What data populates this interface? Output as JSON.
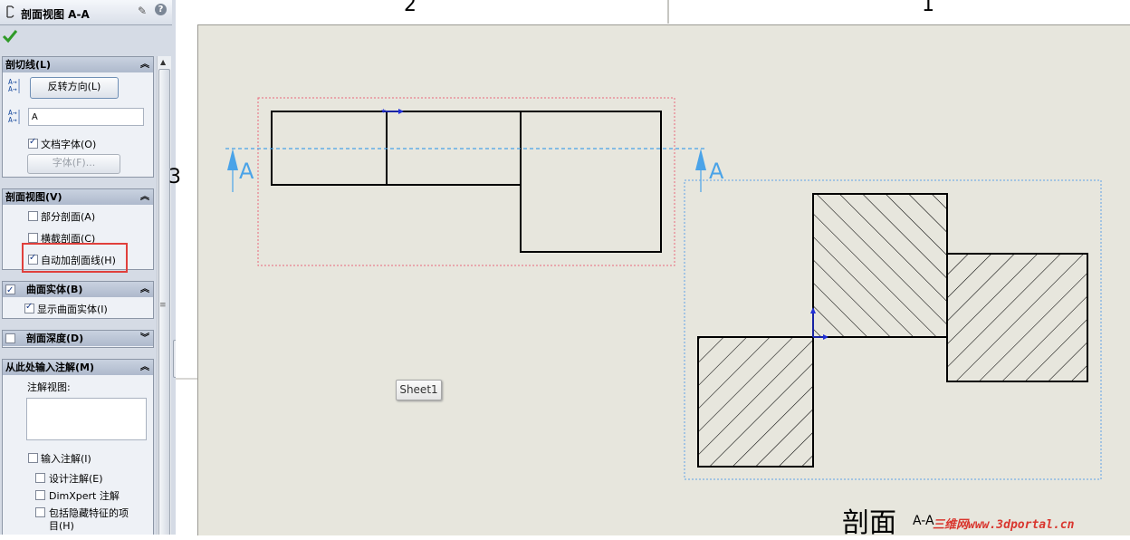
{
  "pm": {
    "title": "剖面视图 A-A",
    "help_icon": "?"
  },
  "cutting_line": {
    "header": "剖切线(L)",
    "reverse_button": "反转方向(L)",
    "label_value": "A",
    "doc_font": "文档字体(O)",
    "font_button": "字体(F)...",
    "doc_font_checked": true
  },
  "section_view": {
    "header": "剖面视图(V)",
    "partial": "部分剖面(A)",
    "slice": "横截剖面(C)",
    "auto_hatch": "自动加剖面线(H)",
    "partial_checked": false,
    "slice_checked": false,
    "auto_hatch_checked": true
  },
  "surface_bodies": {
    "header": "曲面实体(B)",
    "show": "显示曲面实体(I)",
    "header_checked": true,
    "show_checked": true
  },
  "section_depth": {
    "header": "剖面深度(D)",
    "checked": false
  },
  "import_annotations": {
    "header": "从此处输入注解(M)",
    "annot_view": "注解视图:",
    "import": "输入注解(I)",
    "design": "设计注解(E)",
    "dimxpert": "DimXpert 注解",
    "hidden": "包括隐藏特征的项",
    "hidden2": "目(H)"
  },
  "canvas": {
    "zone_2": "2",
    "zone_1": "1",
    "zone_side": "3",
    "cut_label_left": "A",
    "cut_label_right": "A",
    "sheet_tab": "Sheet1",
    "section_title": "剖面",
    "section_sub": "A-A",
    "watermark": "三维网www.3dportal.cn"
  },
  "colors": {
    "sheet_bg": "#e7e6dd",
    "cut_line": "#4aa3e8",
    "selection_box": "#e8687a",
    "view_box": "#5fa3e6",
    "highlight_box": "#e0403c"
  }
}
